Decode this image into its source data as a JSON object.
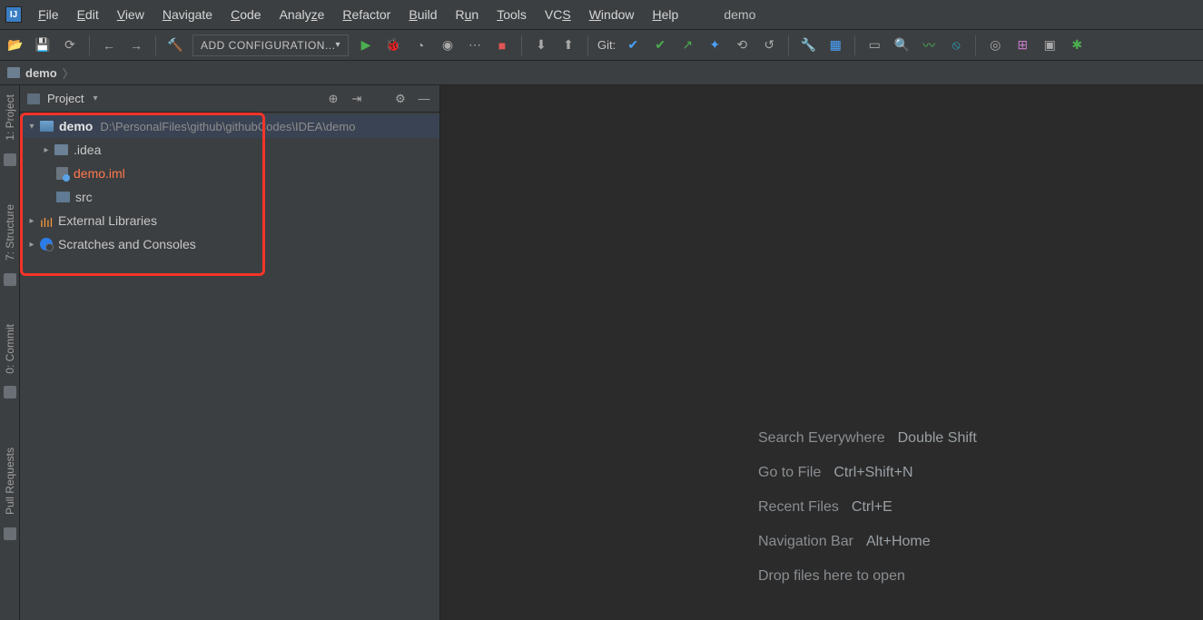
{
  "app_name": "demo",
  "menu": {
    "file": "File",
    "edit": "Edit",
    "view": "View",
    "navigate": "Navigate",
    "code": "Code",
    "analyze": "Analyze",
    "refactor": "Refactor",
    "build": "Build",
    "run": "Run",
    "tools": "Tools",
    "vcs": "VCS",
    "window": "Window",
    "help": "Help",
    "project": "demo"
  },
  "toolbar": {
    "config": "ADD CONFIGURATION...",
    "git": "Git:"
  },
  "breadcrumb": {
    "root": "demo"
  },
  "rail": {
    "project": "1: Project",
    "structure": "7: Structure",
    "commit": "0: Commit",
    "pull": "Pull Requests"
  },
  "panel": {
    "title": "Project"
  },
  "tree": {
    "root": {
      "name": "demo",
      "path": "D:\\PersonalFiles\\github\\githubCodes\\IDEA\\demo"
    },
    "idea": ".idea",
    "iml": "demo.iml",
    "src": "src",
    "ext": "External Libraries",
    "scratch": "Scratches and Consoles"
  },
  "hints": {
    "search": {
      "l": "Search Everywhere",
      "k": "Double Shift"
    },
    "goto": {
      "l": "Go to File",
      "k": "Ctrl+Shift+N"
    },
    "recent": {
      "l": "Recent Files",
      "k": "Ctrl+E"
    },
    "nav": {
      "l": "Navigation Bar",
      "k": "Alt+Home"
    },
    "drop": "Drop files here to open"
  }
}
